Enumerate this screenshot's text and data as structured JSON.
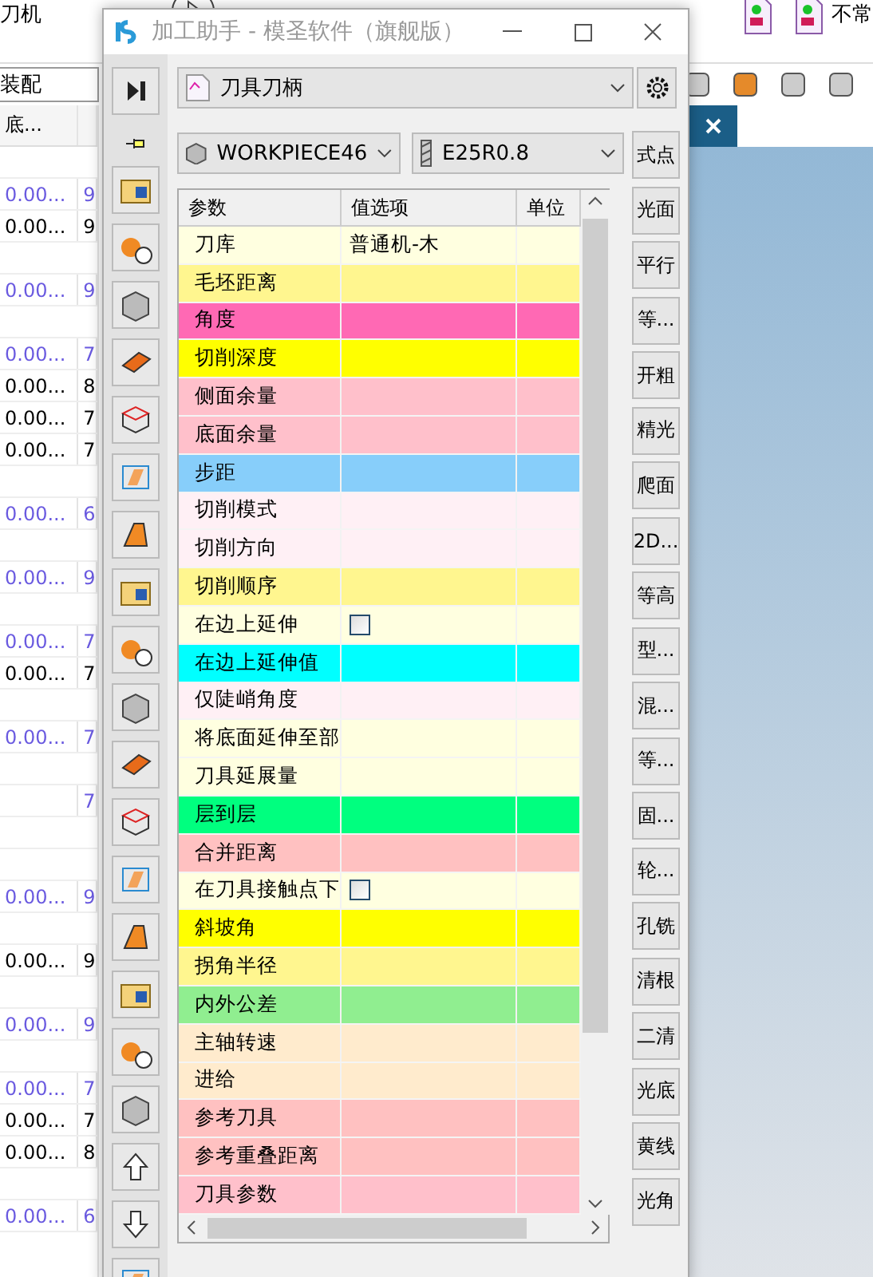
{
  "background": {
    "ribbon": {
      "left_label": "刀机",
      "right_label": "不常"
    },
    "assembly_field": {
      "value": "装配"
    },
    "grid": {
      "header": "底...",
      "rows": [
        {
          "kind": "empty"
        },
        {
          "kind": "data",
          "value": "0.00...",
          "digit": "9",
          "color": "#6a5ae0"
        },
        {
          "kind": "data",
          "value": "0.00...",
          "digit": "9",
          "color": "#000000"
        },
        {
          "kind": "empty"
        },
        {
          "kind": "data",
          "value": "0.00...",
          "digit": "9",
          "color": "#6a5ae0"
        },
        {
          "kind": "empty"
        },
        {
          "kind": "data",
          "value": "0.00...",
          "digit": "7",
          "color": "#6a5ae0"
        },
        {
          "kind": "data",
          "value": "0.00...",
          "digit": "8",
          "color": "#000000"
        },
        {
          "kind": "data",
          "value": "0.00...",
          "digit": "7",
          "color": "#000000"
        },
        {
          "kind": "data",
          "value": "0.00...",
          "digit": "7",
          "color": "#000000"
        },
        {
          "kind": "empty"
        },
        {
          "kind": "data",
          "value": "0.00...",
          "digit": "6",
          "color": "#6a5ae0"
        },
        {
          "kind": "empty"
        },
        {
          "kind": "data",
          "value": "0.00...",
          "digit": "9",
          "color": "#6a5ae0"
        },
        {
          "kind": "empty"
        },
        {
          "kind": "data",
          "value": "0.00...",
          "digit": "7",
          "color": "#6a5ae0"
        },
        {
          "kind": "data",
          "value": "0.00...",
          "digit": "7",
          "color": "#000000"
        },
        {
          "kind": "empty"
        },
        {
          "kind": "data",
          "value": "0.00...",
          "digit": "7",
          "color": "#6a5ae0"
        },
        {
          "kind": "empty"
        },
        {
          "kind": "data",
          "digit": "7",
          "color": "#6a5ae0"
        },
        {
          "kind": "empty"
        },
        {
          "kind": "empty"
        },
        {
          "kind": "data",
          "value": "0.00...",
          "digit": "9",
          "color": "#6a5ae0"
        },
        {
          "kind": "empty"
        },
        {
          "kind": "data",
          "value": "0.00...",
          "digit": "9",
          "color": "#000000"
        },
        {
          "kind": "empty"
        },
        {
          "kind": "data",
          "value": "0.00...",
          "digit": "9",
          "color": "#6a5ae0"
        },
        {
          "kind": "empty"
        },
        {
          "kind": "data",
          "value": "0.00...",
          "digit": "7",
          "color": "#6a5ae0"
        },
        {
          "kind": "data",
          "value": "0.00...",
          "digit": "7",
          "color": "#000000"
        },
        {
          "kind": "data",
          "value": "0.00...",
          "digit": "8",
          "color": "#000000"
        },
        {
          "kind": "empty"
        },
        {
          "kind": "data",
          "value": "0.00...",
          "digit": "6",
          "color": "#6a5ae0"
        }
      ]
    }
  },
  "dialog": {
    "title": "加工助手 - 模圣软件（旗舰版）",
    "category": {
      "value": "刀具刀柄"
    },
    "workpiece": {
      "value": "WORKPIECE46"
    },
    "tool": {
      "value": "E25R0.8"
    },
    "table": {
      "columns": [
        "参数",
        "值选项",
        "单位"
      ],
      "rows": [
        {
          "kind": "text",
          "name": "刀库",
          "value": "普通机-木",
          "color": "#ffffe0"
        },
        {
          "kind": "text",
          "name": "毛坯距离",
          "color": "#fff68f"
        },
        {
          "kind": "text",
          "name": "角度",
          "color": "#ff69b4"
        },
        {
          "kind": "text",
          "name": "切削深度",
          "color": "#ffff00"
        },
        {
          "kind": "text",
          "name": "侧面余量",
          "color": "#ffc0cb"
        },
        {
          "kind": "text",
          "name": "底面余量",
          "color": "#ffc0cb"
        },
        {
          "kind": "text",
          "name": "步距",
          "color": "#87cefa"
        },
        {
          "kind": "text",
          "name": "切削模式",
          "color": "#fff0f5"
        },
        {
          "kind": "text",
          "name": "切削方向",
          "color": "#fff0f5"
        },
        {
          "kind": "text",
          "name": "切削顺序",
          "color": "#fff68f"
        },
        {
          "kind": "checkbox",
          "name": "在边上延伸",
          "checked": false,
          "color": "#ffffe0"
        },
        {
          "kind": "text",
          "name": "在边上延伸值",
          "color": "#00ffff"
        },
        {
          "kind": "text",
          "name": "仅陡峭角度",
          "color": "#fff0f5"
        },
        {
          "kind": "text",
          "name": "将底面延伸至部",
          "color": "#ffffe0"
        },
        {
          "kind": "text",
          "name": "刀具延展量",
          "color": "#ffffe0"
        },
        {
          "kind": "text",
          "name": "层到层",
          "color": "#00ff7f"
        },
        {
          "kind": "text",
          "name": "合并距离",
          "color": "#ffc1c1"
        },
        {
          "kind": "checkbox",
          "name": "在刀具接触点下",
          "checked": false,
          "color": "#ffffe0"
        },
        {
          "kind": "text",
          "name": "斜坡角",
          "color": "#ffff00"
        },
        {
          "kind": "text",
          "name": "拐角半径",
          "color": "#fff68f"
        },
        {
          "kind": "text",
          "name": "内外公差",
          "color": "#90ee90"
        },
        {
          "kind": "text",
          "name": "主轴转速",
          "color": "#ffebcd"
        },
        {
          "kind": "text",
          "name": "进给",
          "color": "#ffebcd"
        },
        {
          "kind": "text",
          "name": "参考刀具",
          "color": "#ffc1c1"
        },
        {
          "kind": "text",
          "name": "参考重叠距离",
          "color": "#ffc1c1"
        },
        {
          "kind": "text",
          "name": "刀具参数",
          "color": "#ffc0cb"
        }
      ]
    },
    "operations": [
      {
        "label": "式点"
      },
      {
        "label": "光面"
      },
      {
        "label": "平行"
      },
      {
        "label": "等..."
      },
      {
        "label": "开粗"
      },
      {
        "label": "精光"
      },
      {
        "label": "爬面"
      },
      {
        "label": "2D..."
      },
      {
        "label": "等高"
      },
      {
        "label": "型..."
      },
      {
        "label": "混..."
      },
      {
        "label": "等..."
      },
      {
        "label": "固..."
      },
      {
        "label": "轮..."
      },
      {
        "label": "孔铣"
      },
      {
        "label": "清根"
      },
      {
        "label": "二清"
      },
      {
        "label": "光底"
      },
      {
        "label": "黄线"
      },
      {
        "label": "光角"
      }
    ]
  }
}
